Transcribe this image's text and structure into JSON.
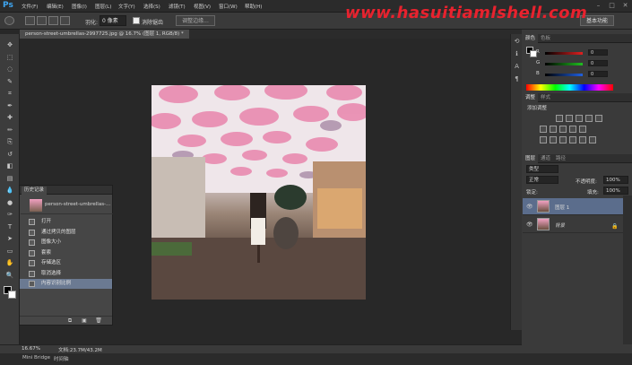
{
  "app": {
    "logo": "Ps"
  },
  "menu": [
    "文件(F)",
    "编辑(E)",
    "图像(I)",
    "图层(L)",
    "文字(Y)",
    "选择(S)",
    "滤镜(T)",
    "视图(V)",
    "窗口(W)",
    "帮助(H)"
  ],
  "window_controls": [
    "–",
    "□",
    "✕"
  ],
  "options_bar": {
    "feather_label": "羽化:",
    "feather_value": "0 像素",
    "antialias_label": "消除锯齿",
    "refine_edge_label": "调整边缘...",
    "workspace": "基本功能"
  },
  "watermark": "www.hasuitiamlshell.com",
  "document": {
    "tab_title": "person-street-umbrellas-2997725.jpg @ 16.7% (图层 1, RGB/8) *",
    "zoom": "16.67%",
    "doc_size": "文档:23.7M/43.2M"
  },
  "bottom_tabs": [
    "Mini Bridge",
    "时间轴"
  ],
  "history": {
    "tab": "历史记录",
    "snapshot": "person-street-umbrellas-...",
    "items": [
      "打开",
      "通过拷贝的图层",
      "图像大小",
      "套索",
      "存储选区",
      "取消选择",
      "内容识别比例"
    ],
    "selected_index": 6
  },
  "color_panel": {
    "tabs": [
      "颜色",
      "色板"
    ],
    "channels": [
      {
        "label": "R",
        "value": "0",
        "color": "#e02020"
      },
      {
        "label": "G",
        "value": "0",
        "color": "#20c020"
      },
      {
        "label": "B",
        "value": "0",
        "color": "#2060e0"
      }
    ]
  },
  "adjustments_panel": {
    "tabs": [
      "调整",
      "样式"
    ],
    "heading": "添加调整"
  },
  "layers_panel": {
    "tabs": [
      "图层",
      "通道",
      "路径"
    ],
    "kind_filter": "类型",
    "blend_mode": "正常",
    "opacity_label": "不透明度:",
    "opacity_value": "100%",
    "lock_label": "锁定:",
    "fill_label": "填充:",
    "fill_value": "100%",
    "layers": [
      {
        "name": "图层 1",
        "selected": true
      },
      {
        "name": "背景",
        "selected": false,
        "locked": true
      }
    ]
  },
  "icons": {
    "tools": [
      "move-icon",
      "marquee-icon",
      "lasso-icon",
      "quick-select-icon",
      "crop-icon",
      "eyedropper-icon",
      "healing-icon",
      "brush-icon",
      "stamp-icon",
      "history-brush-icon",
      "eraser-icon",
      "gradient-icon",
      "blur-icon",
      "dodge-icon",
      "pen-icon",
      "type-icon",
      "path-select-icon",
      "shape-icon",
      "hand-icon",
      "zoom-icon"
    ]
  },
  "colors": {
    "accent": "#3ea6f2",
    "selection": "#5b6d8c",
    "history_selection": "#6b7a92",
    "watermark": "#e8222e"
  }
}
